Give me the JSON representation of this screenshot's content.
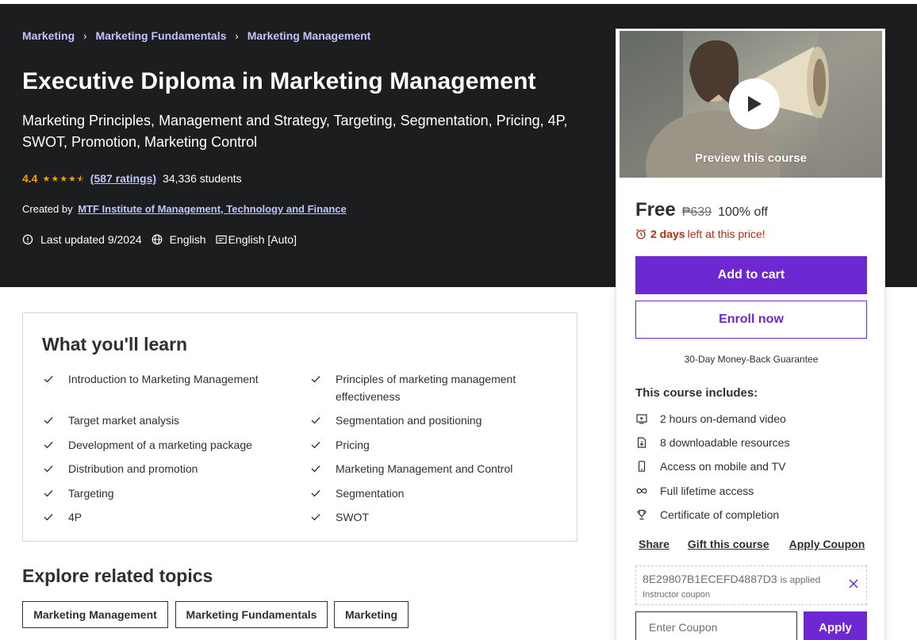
{
  "breadcrumb": [
    "Marketing",
    "Marketing Fundamentals",
    "Marketing Management"
  ],
  "course": {
    "title": "Executive Diploma in Marketing Management",
    "subtitle": "Marketing Principles, Management and Strategy, Targeting, Segmentation, Pricing, 4P, SWOT, Promotion, Marketing Control",
    "rating": "4.4",
    "rating_value": 4.4,
    "ratings_count": "(587 ratings)",
    "students": "34,336 students",
    "created_by_label": "Created by",
    "instructor": "MTF Institute of Management, Technology and Finance",
    "last_updated": "Last updated 9/2024",
    "language": "English",
    "captions": "English [Auto]"
  },
  "learn": {
    "title": "What you'll learn",
    "items": [
      "Introduction to Marketing Management",
      "Principles of marketing management effectiveness",
      "Target market analysis",
      "Segmentation and positioning",
      "Development of a marketing package",
      "Pricing",
      "Distribution and promotion",
      "Marketing Management and Control",
      "Targeting",
      "Segmentation",
      "4P",
      "SWOT"
    ]
  },
  "explore": {
    "title": "Explore related topics",
    "topics": [
      "Marketing Management",
      "Marketing Fundamentals",
      "Marketing"
    ]
  },
  "sidebar": {
    "preview_label": "Preview this course",
    "price": "Free",
    "original_price": "₱639",
    "discount": "100% off",
    "deadline_bold": "2 days",
    "deadline_rest": "left at this price!",
    "add_to_cart": "Add to cart",
    "enroll_now": "Enroll now",
    "guarantee": "30-Day Money-Back Guarantee",
    "includes_title": "This course includes:",
    "includes": [
      "2 hours on-demand video",
      "8 downloadable resources",
      "Access on mobile and TV",
      "Full lifetime access",
      "Certificate of completion"
    ],
    "links": [
      "Share",
      "Gift this course",
      "Apply Coupon"
    ],
    "coupon_code": "8E29807B1ECEFD4887D3",
    "coupon_applied": "is applied",
    "coupon_type": "Instructor coupon",
    "coupon_placeholder": "Enter Coupon",
    "apply": "Apply"
  },
  "colors": {
    "hero_bg": "#1c1d1f",
    "accent_purple": "#6d28d2",
    "link_lavender": "#c0c4fc",
    "star_orange": "#f69c08",
    "deadline_red": "#b32d0f"
  }
}
